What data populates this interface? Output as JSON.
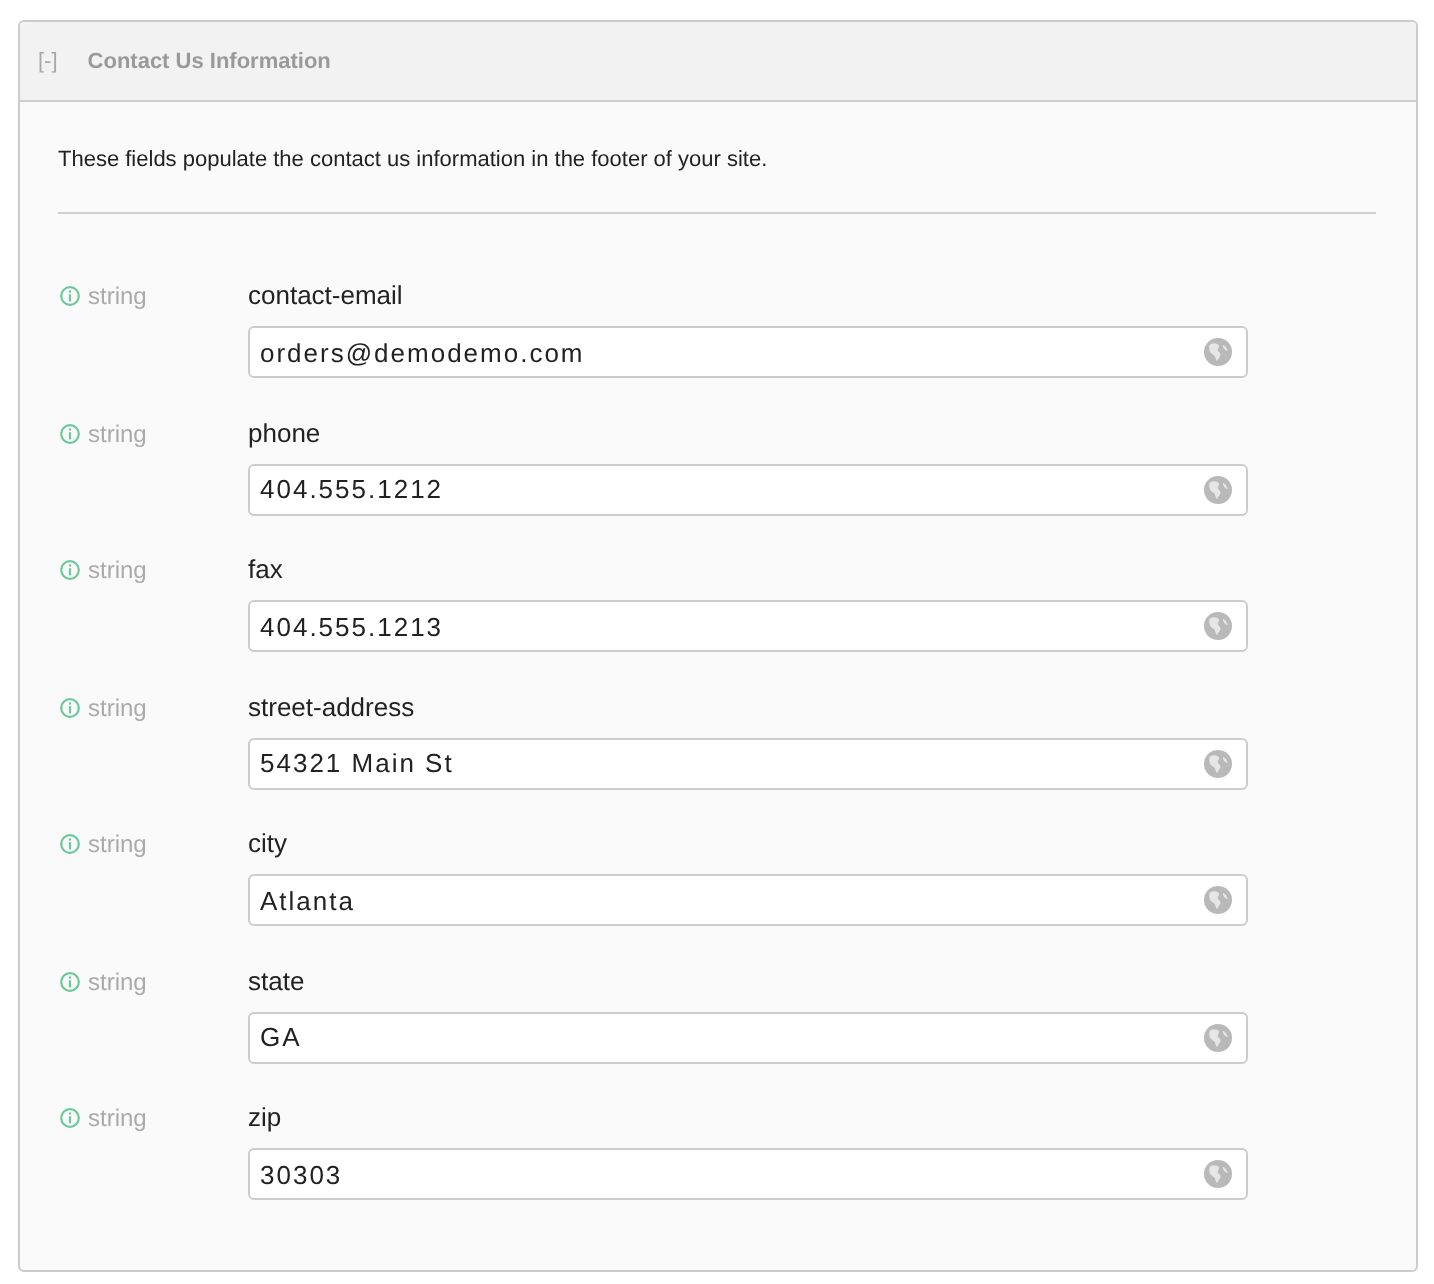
{
  "panel": {
    "toggle": "[-]",
    "title": "Contact Us Information"
  },
  "description": "These fields populate the contact us information in the footer of your site.",
  "fields": [
    {
      "type": "string",
      "label": "contact-email",
      "value": "orders@demodemo.com"
    },
    {
      "type": "string",
      "label": "phone",
      "value": "404.555.1212"
    },
    {
      "type": "string",
      "label": "fax",
      "value": "404.555.1213"
    },
    {
      "type": "string",
      "label": "street-address",
      "value": "54321 Main St"
    },
    {
      "type": "string",
      "label": "city",
      "value": "Atlanta"
    },
    {
      "type": "string",
      "label": "state",
      "value": "GA"
    },
    {
      "type": "string",
      "label": "zip",
      "value": "30303"
    }
  ]
}
